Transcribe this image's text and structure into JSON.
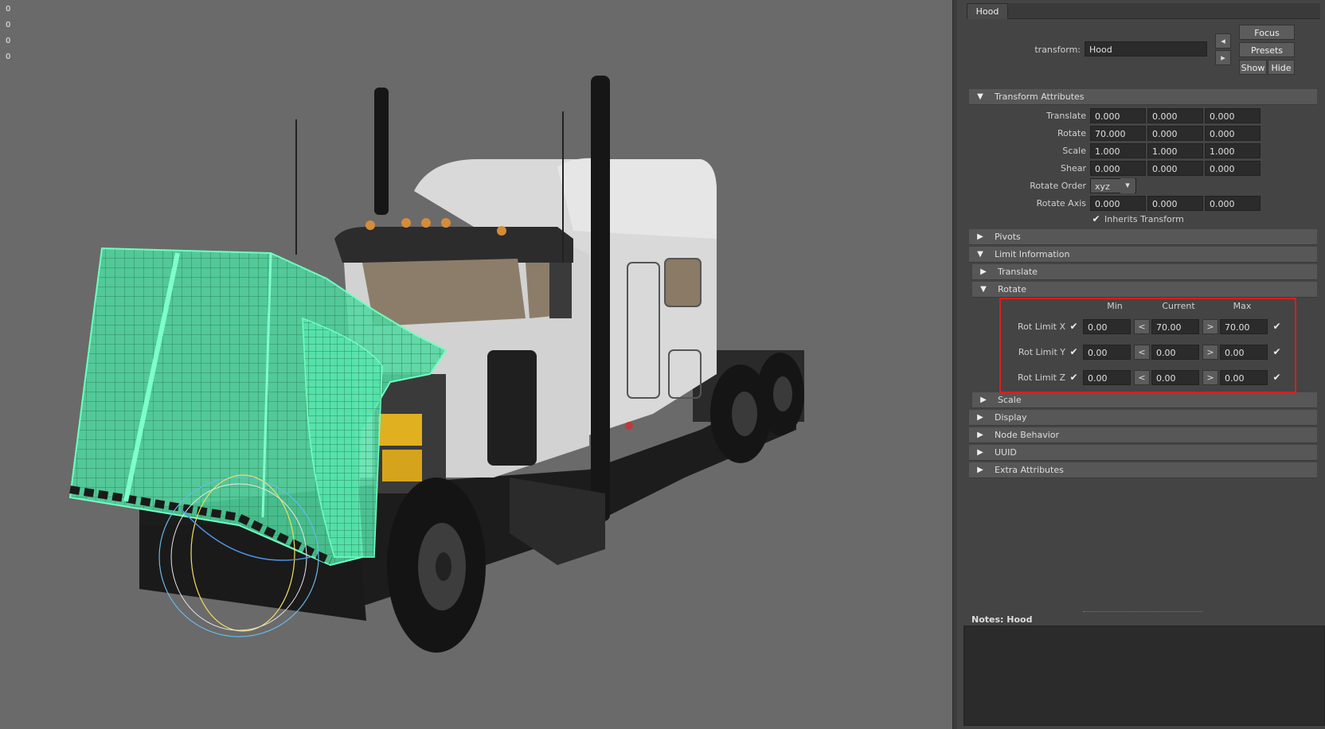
{
  "viewport": {
    "hud_values": [
      "0",
      "0",
      "0",
      "0"
    ]
  },
  "attribute_editor": {
    "tab": "Hood",
    "transform_label": "transform:",
    "transform_name": "Hood",
    "buttons": {
      "focus": "Focus",
      "presets": "Presets",
      "show": "Show",
      "hide": "Hide"
    },
    "transform_attributes": {
      "title": "Transform Attributes",
      "rows": [
        {
          "label": "Translate",
          "values": [
            "0.000",
            "0.000",
            "0.000"
          ]
        },
        {
          "label": "Rotate",
          "values": [
            "70.000",
            "0.000",
            "0.000"
          ]
        },
        {
          "label": "Scale",
          "values": [
            "1.000",
            "1.000",
            "1.000"
          ]
        },
        {
          "label": "Shear",
          "values": [
            "0.000",
            "0.000",
            "0.000"
          ]
        }
      ],
      "rotate_order_label": "Rotate Order",
      "rotate_order_value": "xyz",
      "rotate_axis_label": "Rotate Axis",
      "rotate_axis_values": [
        "0.000",
        "0.000",
        "0.000"
      ],
      "inherits_transform_label": "Inherits Transform",
      "inherits_transform_checked": true
    },
    "sections": {
      "pivots": "Pivots",
      "limit_information": "Limit Information",
      "translate": "Translate",
      "rotate": "Rotate",
      "scale": "Scale",
      "display": "Display",
      "node_behavior": "Node Behavior",
      "uuid": "UUID",
      "extra_attributes": "Extra Attributes"
    },
    "rotate_limits": {
      "headers": {
        "min": "Min",
        "current": "Current",
        "max": "Max"
      },
      "less_symbol": "<",
      "greater_symbol": ">",
      "rows": [
        {
          "label": "Rot Limit X",
          "min": "0.00",
          "current": "70.00",
          "max": "70.00"
        },
        {
          "label": "Rot Limit Y",
          "min": "0.00",
          "current": "0.00",
          "max": "0.00"
        },
        {
          "label": "Rot Limit Z",
          "min": "0.00",
          "current": "0.00",
          "max": "0.00"
        }
      ]
    },
    "notes_label": "Notes:",
    "notes_name": "Hood"
  },
  "colors": {
    "viewport_bg": "#6a6a6a",
    "panel_bg": "#444444",
    "field_bg": "#2b2b2b",
    "selection_wire": "#5ef0a8",
    "highlight_box": "#e01b1b"
  }
}
